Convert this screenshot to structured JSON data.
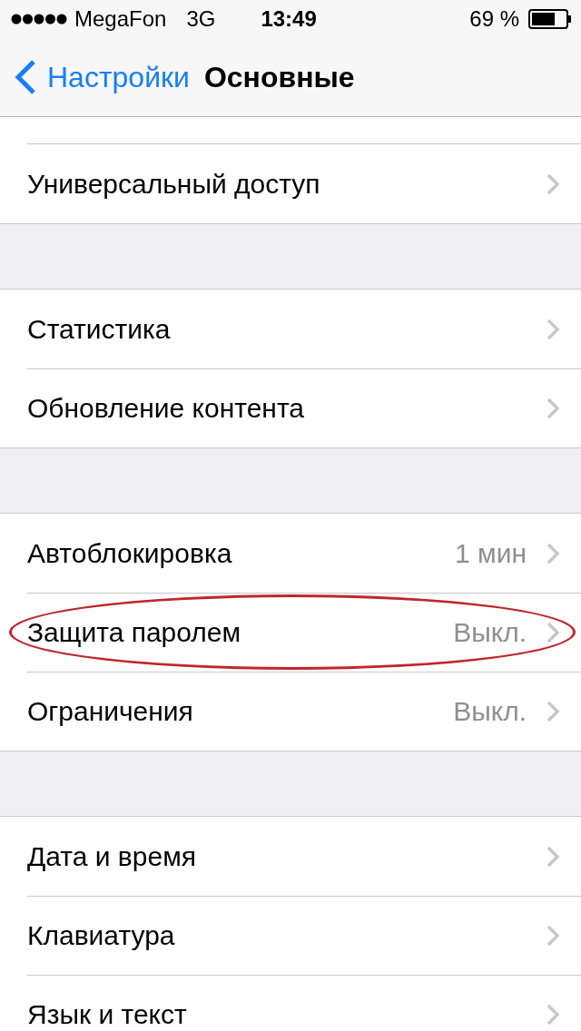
{
  "status_bar": {
    "carrier": "MegaFon",
    "network": "3G",
    "time": "13:49",
    "battery": "69 %"
  },
  "nav": {
    "back": "Настройки",
    "title": "Основные"
  },
  "groups": [
    {
      "items": [
        {
          "label": "Универсальный доступ",
          "annotated": false
        }
      ]
    },
    {
      "items": [
        {
          "label": "Статистика",
          "annotated": false
        },
        {
          "label": "Обновление контента",
          "annotated": false
        }
      ]
    },
    {
      "items": [
        {
          "label": "Автоблокировка",
          "value": "1 мин",
          "annotated": false
        },
        {
          "label": "Защита паролем",
          "value": "Выкл.",
          "annotated": true
        },
        {
          "label": "Ограничения",
          "value": "Выкл.",
          "annotated": false
        }
      ]
    },
    {
      "items": [
        {
          "label": "Дата и время",
          "annotated": false
        },
        {
          "label": "Клавиатура",
          "annotated": false
        },
        {
          "label": "Язык и текст",
          "annotated": false
        }
      ]
    }
  ]
}
